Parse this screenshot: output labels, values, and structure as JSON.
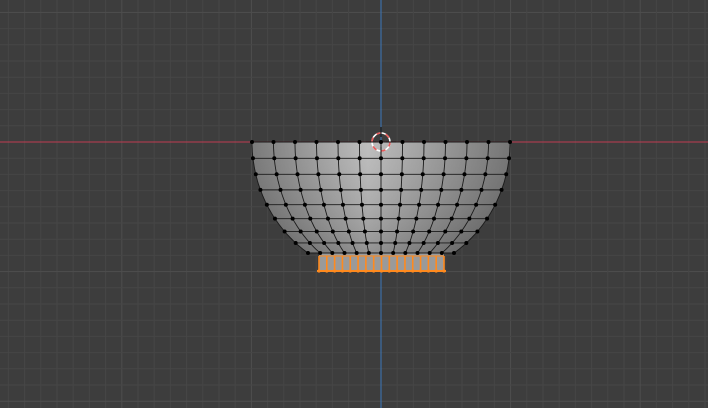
{
  "viewport": {
    "mode": "edit-mode",
    "view": "front-orthographic",
    "object": "bowl-mesh"
  },
  "colors": {
    "background": "#3d3d3d",
    "grid_minor": "#464646",
    "grid_major": "#4e4e4e",
    "x_axis": "#a63d4e",
    "z_axis": "#3d6fa6",
    "mesh_light": "#b8b8b8",
    "mesh_dark": "#6f6f6f",
    "edge": "#1a1a1a",
    "vertex": "#000000",
    "selected": "#ff8a1e",
    "cursor_red": "#e85a5a",
    "cursor_white": "#ffffff"
  },
  "mesh": {
    "rings": 8,
    "segments": 12,
    "foot_segments": 16,
    "foot_selected": true
  }
}
